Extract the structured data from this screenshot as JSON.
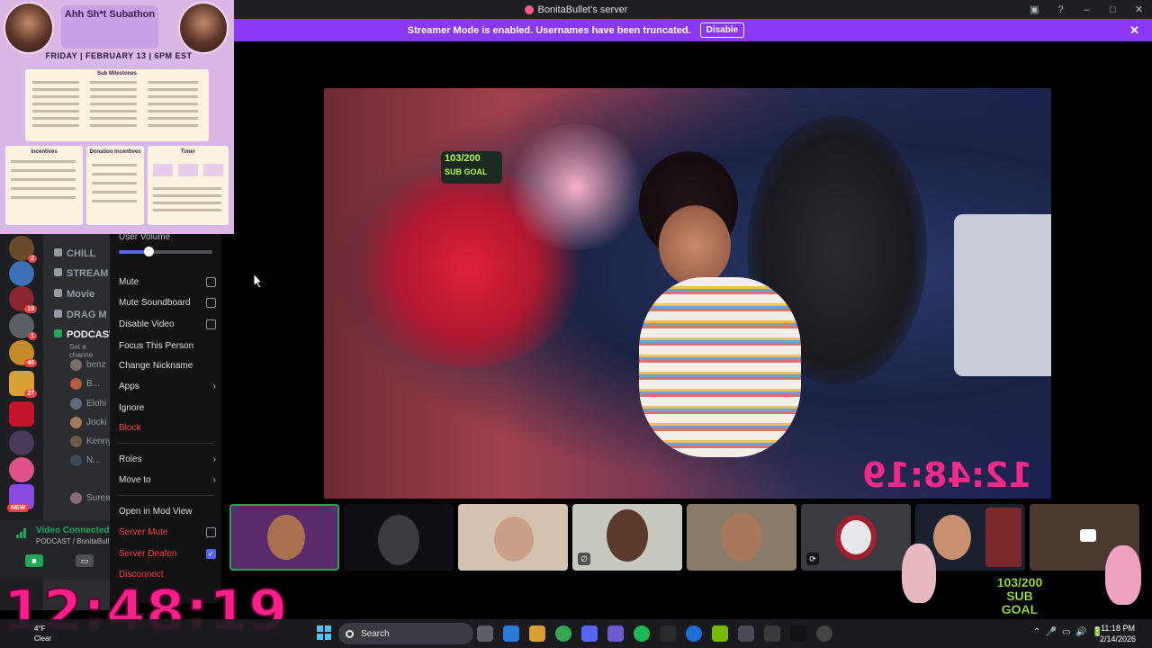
{
  "window": {
    "title": "BonitaBullet's server"
  },
  "banner": {
    "message": "Streamer Mode is enabled. Usernames have been truncated.",
    "disable_label": "Disable"
  },
  "overlay_schedule": {
    "title": "Ahh Sh*t Subathon",
    "date": "FRIDAY | FEBRUARY 13 | 6PM EST",
    "milestones_heading": "Sub Milestones",
    "incentives_heading": "Incentives",
    "donation_heading": "Donation Incentives",
    "timer_heading": "Timer"
  },
  "channels": [
    {
      "name": "CHILL",
      "icon": "speaker-icon"
    },
    {
      "name": "STREAM",
      "icon": "speaker-icon"
    },
    {
      "name": "Movie",
      "icon": "speaker-icon"
    },
    {
      "name": "DRAG M",
      "icon": "speaker-icon"
    },
    {
      "name": "PODCAST",
      "icon": "stage-icon",
      "sub": "Set a channe"
    }
  ],
  "members": [
    {
      "name": "benz",
      "color": "#7a6e66"
    },
    {
      "name": "B...",
      "color": "#b55a3c"
    },
    {
      "name": "Elohi",
      "color": "#5a6b7a"
    },
    {
      "name": "Jocki",
      "color": "#a87a5a"
    },
    {
      "name": "Kenny",
      "color": "#6a5a4a"
    },
    {
      "name": "N...",
      "color": "#3a4a5a"
    },
    {
      "name": "Surea",
      "color": "#8a6a7a"
    }
  ],
  "rail_badges": [
    "2",
    "19",
    "1",
    "40",
    "27"
  ],
  "rail_new": "NEW",
  "voice": {
    "status": "Video Connected",
    "location": "PODCAST / BonitaBull"
  },
  "context_menu": {
    "user_volume_label": "User Volume",
    "user_volume": 0.32,
    "items": [
      {
        "label": "Mute",
        "type": "checkbox",
        "checked": false
      },
      {
        "label": "Mute Soundboard",
        "type": "checkbox",
        "checked": false
      },
      {
        "label": "Disable Video",
        "type": "checkbox",
        "checked": false
      },
      {
        "label": "Focus This Person",
        "type": "action"
      },
      {
        "label": "Change Nickname",
        "type": "action"
      },
      {
        "label": "Apps",
        "type": "submenu"
      },
      {
        "label": "Ignore",
        "type": "action"
      },
      {
        "label": "Block",
        "type": "danger"
      },
      {
        "label": "Roles",
        "type": "submenu"
      },
      {
        "label": "Move to",
        "type": "submenu"
      },
      {
        "label": "Open in Mod View",
        "type": "action"
      },
      {
        "label": "Server Mute",
        "type": "danger-checkbox",
        "checked": false
      },
      {
        "label": "Server Deafen",
        "type": "danger-checkbox",
        "checked": true
      },
      {
        "label": "Disconnect",
        "type": "danger"
      }
    ]
  },
  "stream": {
    "goal_text": "103/200",
    "goal_label": "SUB GOAL",
    "mirrored_timer": "12:48:19"
  },
  "sub_goal_overlay": {
    "count": "103/200",
    "label": "SUB GOAL"
  },
  "big_timer": "12:48:19",
  "taskbar": {
    "temp": "4°F",
    "weather": "Clear",
    "search_placeholder": "Search",
    "time": "11:18 PM",
    "date": "2/14/2026"
  },
  "colors": {
    "accent": "#5865f2",
    "streamer_banner": "#8a38f5",
    "danger": "#f23f43",
    "connected": "#23a55a",
    "timer_pink": "#ff1f8a",
    "goal_green": "#b7f54a"
  }
}
